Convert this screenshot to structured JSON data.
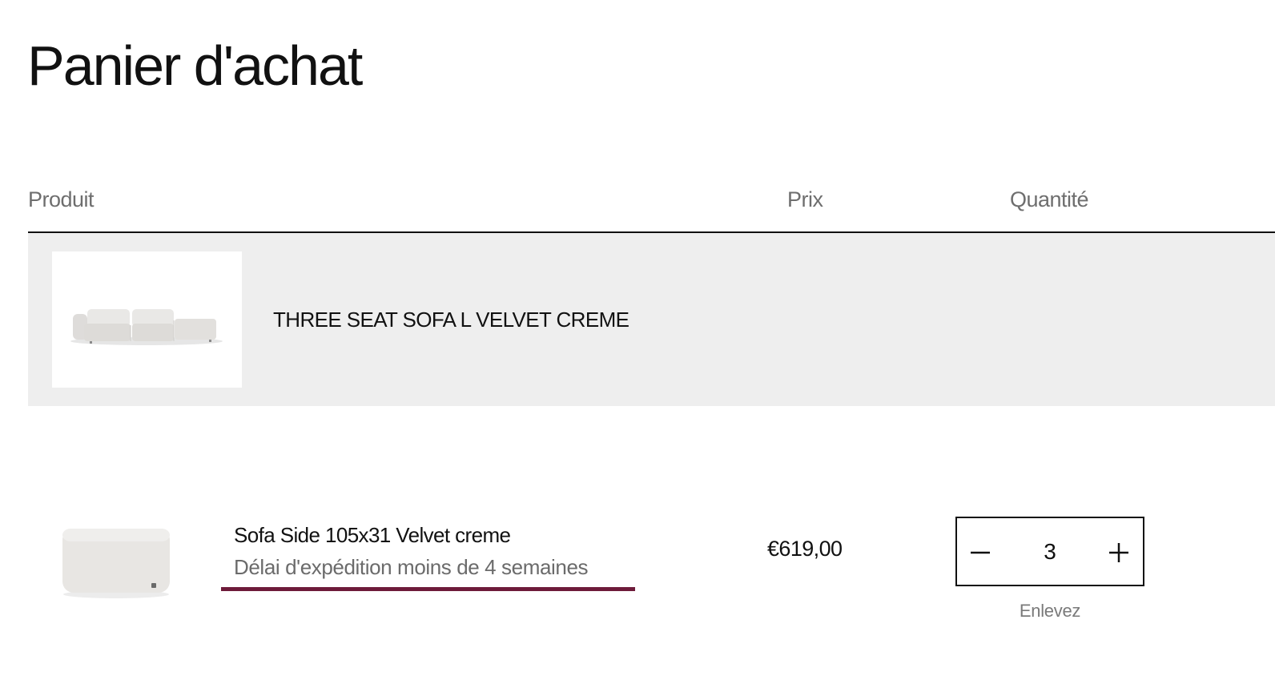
{
  "page": {
    "title": "Panier d'achat"
  },
  "table": {
    "columns": {
      "product": "Produit",
      "price": "Prix",
      "quantity": "Quantité"
    }
  },
  "bundle": {
    "title": "THREE SEAT SOFA L VELVET CREME",
    "image_icon": "sofa-image"
  },
  "items": [
    {
      "name": "Sofa Side 105x31 Velvet creme",
      "delivery": "Délai d'expédition moins de 4 semaines",
      "price": "€619,00",
      "quantity": "3",
      "decrease_icon": "minus-icon",
      "increase_icon": "plus-icon",
      "remove_label": "Enlevez"
    }
  ],
  "colors": {
    "accent_underline": "#6e1b3a",
    "bundle_background": "#eeeeee",
    "muted_text": "#6e6e6e"
  }
}
